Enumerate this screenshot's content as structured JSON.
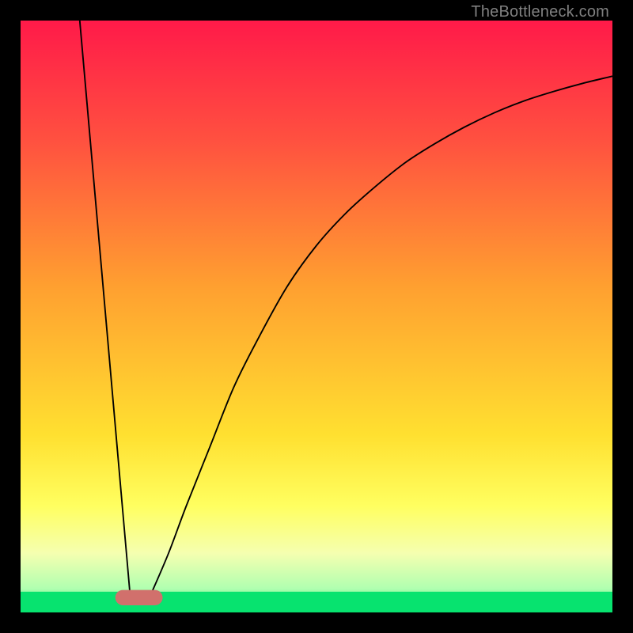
{
  "watermark": "TheBottleneck.com",
  "chart_data": {
    "type": "line",
    "title": "",
    "xlabel": "",
    "ylabel": "",
    "xlim": [
      0,
      100
    ],
    "ylim": [
      0,
      100
    ],
    "background_gradient": {
      "stops": [
        {
          "offset": 0.0,
          "color": "#ff1a49"
        },
        {
          "offset": 0.2,
          "color": "#ff5040"
        },
        {
          "offset": 0.45,
          "color": "#ffa030"
        },
        {
          "offset": 0.7,
          "color": "#ffe030"
        },
        {
          "offset": 0.82,
          "color": "#ffff60"
        },
        {
          "offset": 0.9,
          "color": "#f5ffb0"
        },
        {
          "offset": 0.96,
          "color": "#b0ffb0"
        },
        {
          "offset": 1.0,
          "color": "#07e36f"
        }
      ]
    },
    "green_band": {
      "y_top": 96.5,
      "y_bottom": 100,
      "color": "#07e36f"
    },
    "marker": {
      "x_center": 20,
      "width": 8,
      "y": 97.5,
      "height": 2.6,
      "color": "#d1706c",
      "rx": 1.3
    },
    "series": [
      {
        "name": "left-line",
        "type": "segment",
        "x": [
          10,
          18.5
        ],
        "y": [
          0,
          97
        ]
      },
      {
        "name": "right-curve",
        "type": "curve",
        "x": [
          22,
          25,
          28,
          32,
          36,
          40,
          45,
          50,
          55,
          60,
          65,
          70,
          75,
          80,
          85,
          90,
          95,
          100
        ],
        "y": [
          97,
          90,
          82,
          72,
          62,
          54,
          45,
          38,
          32.5,
          28,
          24,
          20.8,
          18,
          15.6,
          13.6,
          12,
          10.6,
          9.4
        ]
      }
    ]
  }
}
